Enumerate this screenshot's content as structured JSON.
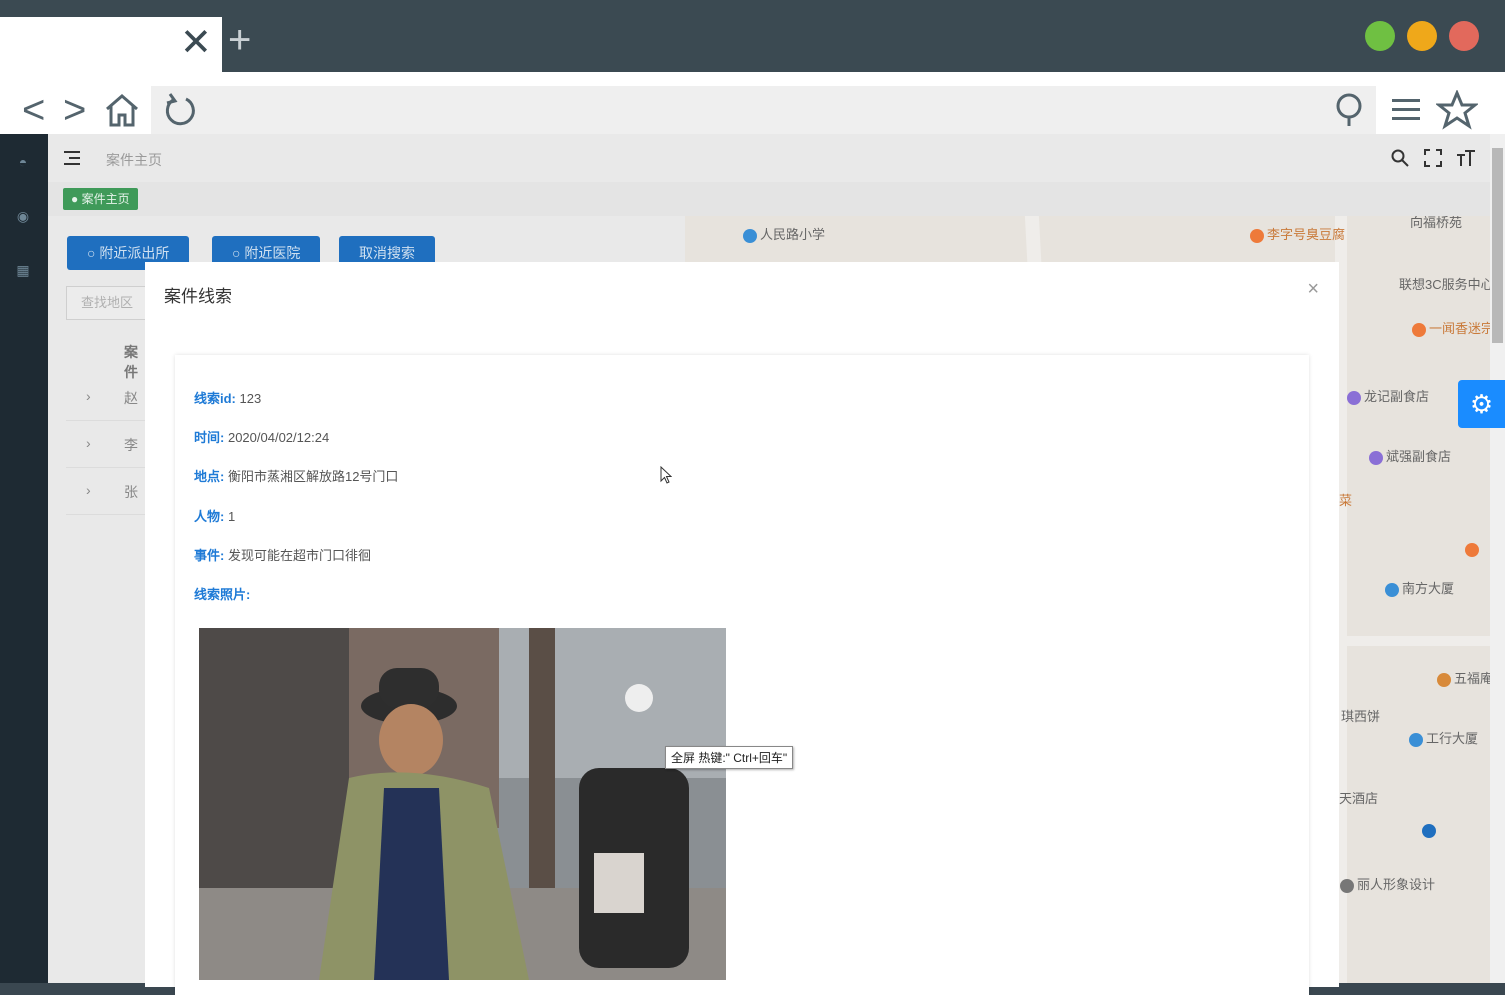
{
  "browser": {
    "tab_close": "✕",
    "new_tab": "+",
    "window_buttons": [
      "#6fc042",
      "#efa81a",
      "#e2695c"
    ],
    "nav": {
      "back": "<",
      "forward": ">"
    }
  },
  "app": {
    "breadcrumb": "案件主页",
    "active_tag": "案件主页",
    "buttons": [
      "附近派出所",
      "附近医院",
      "取消搜索"
    ],
    "search_placeholder": "查找地区",
    "table_header": "案件",
    "rows": [
      "赵",
      "李",
      "张"
    ]
  },
  "map": {
    "pois": [
      "人民路小学",
      "李字号臭豆腐",
      "向福桥苑",
      "联想3C服务中心",
      "一闻香迷宗蟹",
      "龙记副食店",
      "斌强副食店",
      "南方大厦",
      "五福庵",
      "琪西饼",
      "工行大厦",
      "天酒店",
      "丽人形象设计",
      "菜"
    ]
  },
  "modal": {
    "title": "案件线索",
    "close": "×",
    "fields": [
      {
        "label": "线索id:",
        "value": "123"
      },
      {
        "label": "时间:",
        "value": "2020/04/02/12:24"
      },
      {
        "label": "地点:",
        "value": "衡阳市蒸湘区解放路12号门口"
      },
      {
        "label": "人物:",
        "value": "1"
      },
      {
        "label": "事件:",
        "value": "发现可能在超市门口徘徊"
      },
      {
        "label": "线索照片:",
        "value": ""
      }
    ]
  },
  "tooltip": "全屏 热键:\" Ctrl+回车\""
}
